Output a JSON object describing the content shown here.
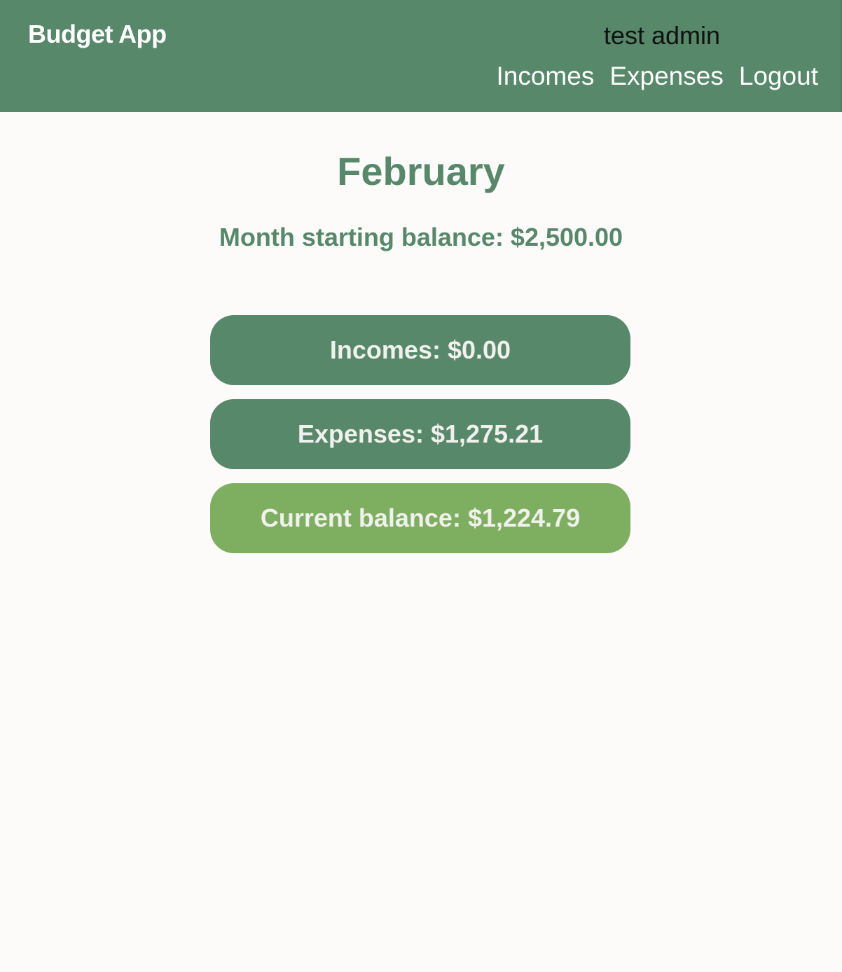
{
  "header": {
    "brand": "Budget App",
    "username": "test admin",
    "nav": {
      "incomes": "Incomes",
      "expenses": "Expenses",
      "logout": "Logout"
    }
  },
  "main": {
    "month": "February",
    "starting_balance": "Month starting balance: $2,500.00",
    "cards": {
      "incomes": "Incomes: $0.00",
      "expenses": "Expenses: $1,275.21",
      "current_balance": "Current balance: $1,224.79"
    }
  },
  "colors": {
    "primary_green": "#568869",
    "accent_green": "#7eae5f",
    "background": "#fcfbf9"
  }
}
